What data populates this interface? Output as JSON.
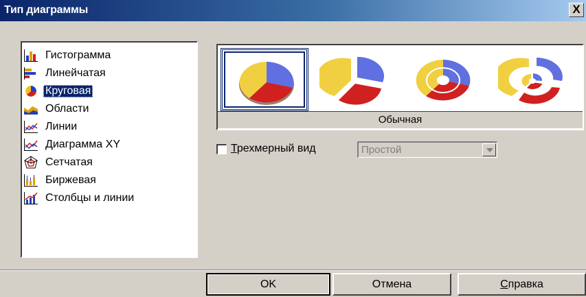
{
  "window": {
    "title": "Тип диаграммы",
    "close_label": "X"
  },
  "chart_types": {
    "selected_index": 2,
    "items": [
      {
        "label": "Гистограмма",
        "icon": "column-chart-icon"
      },
      {
        "label": "Линейчатая",
        "icon": "bar-chart-icon"
      },
      {
        "label": "Круговая",
        "icon": "pie-chart-icon"
      },
      {
        "label": "Области",
        "icon": "area-chart-icon"
      },
      {
        "label": "Линии",
        "icon": "line-chart-icon"
      },
      {
        "label": "Диаграмма XY",
        "icon": "xy-chart-icon"
      },
      {
        "label": "Сетчатая",
        "icon": "net-chart-icon"
      },
      {
        "label": "Биржевая",
        "icon": "stock-chart-icon"
      },
      {
        "label": "Столбцы и линии",
        "icon": "column-line-chart-icon"
      }
    ]
  },
  "variants": {
    "selected_caption": "Обычная",
    "items": [
      {
        "icon": "pie-normal-icon"
      },
      {
        "icon": "pie-exploded-icon"
      },
      {
        "icon": "donut-icon"
      },
      {
        "icon": "donut-exploded-icon"
      }
    ]
  },
  "options": {
    "three_d_accel": "Т",
    "three_d_rest": "рехмерный вид",
    "three_d_checked": false,
    "shape_value": "Простой"
  },
  "buttons": {
    "ok": "OK",
    "cancel": "Отмена",
    "help_accel": "С",
    "help_rest": "правка"
  },
  "colors": {
    "yellow": "#f0d040",
    "blue": "#6070e0",
    "red": "#d02020",
    "selection": "#0a246a"
  }
}
